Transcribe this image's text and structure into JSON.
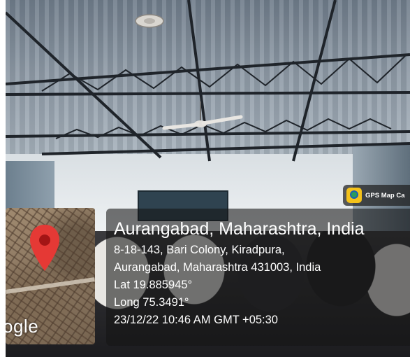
{
  "gps_badge": {
    "icon": "gps-map-camera-app-icon",
    "app_name": "GPS Map Ca"
  },
  "map": {
    "pin_icon": "location-pin-icon",
    "pin_color": "#e53935",
    "watermark": "ogle"
  },
  "location": {
    "title": "Aurangabad, Maharashtra, India",
    "address_line_1": "8-18-143, Bari Colony, Kiradpura,",
    "address_line_2": "Aurangabad, Maharashtra 431003, India",
    "latitude": "Lat 19.885945°",
    "longitude": "Long 75.3491°",
    "datetime": "23/12/22 10:46 AM GMT +05:30"
  }
}
